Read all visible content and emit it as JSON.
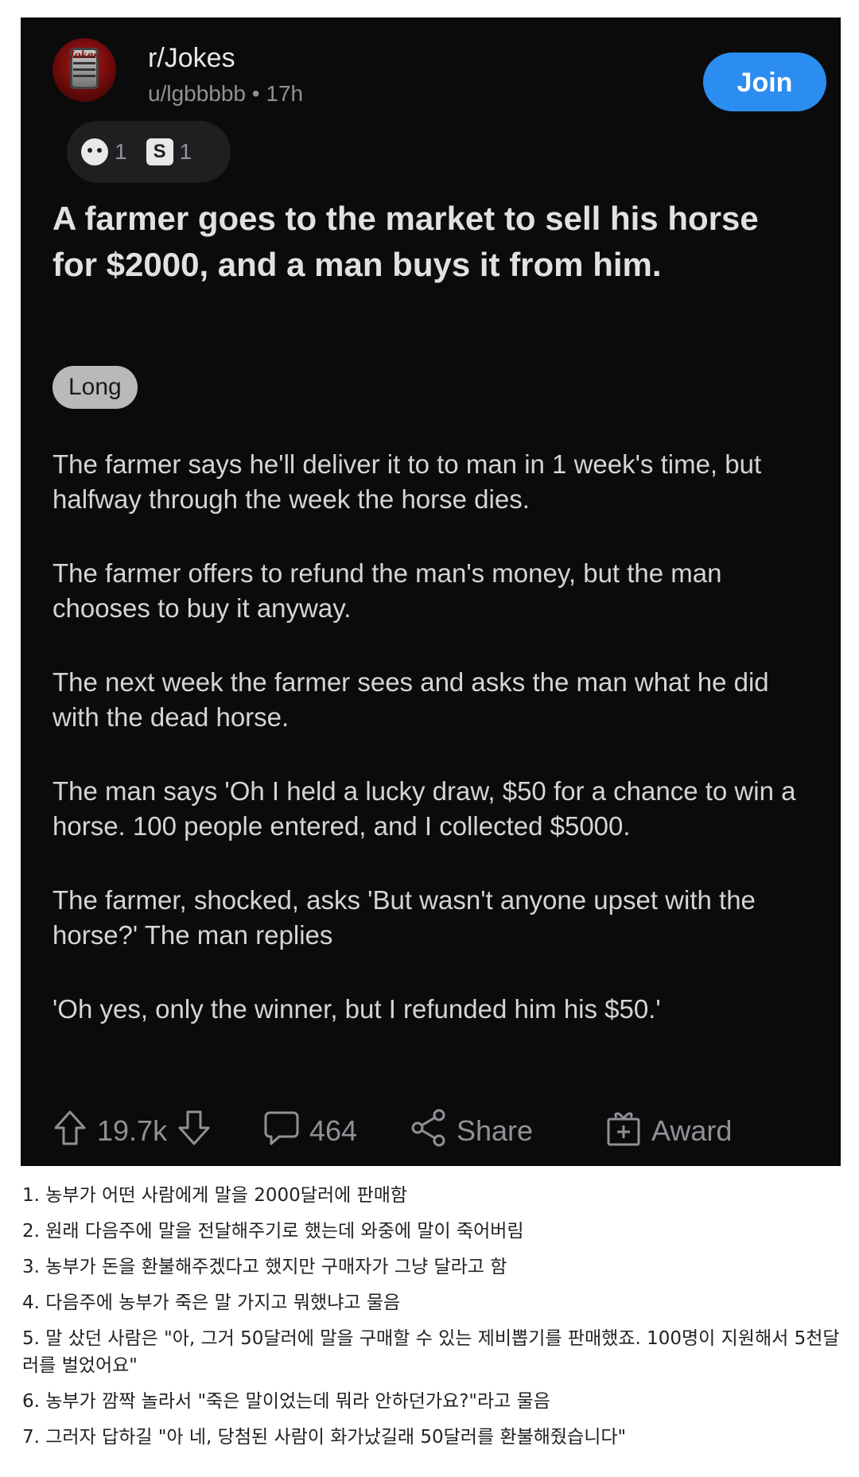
{
  "post": {
    "subreddit": "r/Jokes",
    "author": "u/lgbbbbb",
    "separator": "•",
    "time": "17h",
    "join_label": "Join",
    "avatar_text": "Jokes",
    "awards": [
      {
        "icon": "wholesome-award-icon",
        "count": "1"
      },
      {
        "icon": "silver-award-icon",
        "glyph": "S",
        "count": "1"
      }
    ],
    "title": "A farmer goes to the market to sell his horse for $2000, and a man buys it from him.",
    "flair": "Long",
    "paragraphs": [
      "The farmer says he'll deliver it to to man in 1 week's time, but halfway through the week the horse dies.",
      "The farmer offers to refund the man's money, but the man chooses to buy it anyway.",
      "The next week the farmer sees and asks the man what he did with the dead horse.",
      "The man says 'Oh I held a lucky draw, $50 for a chance to win a horse. 100 people entered, and I collected $5000.",
      "The farmer, shocked, asks 'But wasn't anyone upset with the horse?' The man replies",
      "'Oh yes, only the winner, but I refunded him his $50.'"
    ],
    "actions": {
      "votes": "19.7k",
      "comments": "464",
      "share": "Share",
      "award": "Award"
    }
  },
  "translation": [
    "1. 농부가 어떤 사람에게 말을 2000달러에 판매함",
    "2. 원래 다음주에 말을 전달해주기로 했는데 와중에 말이 죽어버림",
    "3. 농부가 돈을 환불해주겠다고 했지만 구매자가 그냥 달라고 함",
    "4. 다음주에 농부가 죽은 말 가지고 뭐했냐고 물음",
    "5. 말 샀던 사람은 \"아, 그거 50달러에 말을 구매할 수 있는 제비뽑기를 판매했죠. 100명이 지원해서 5천달러를 벌었어요\"",
    "6. 농부가 깜짝 놀라서 \"죽은 말이었는데 뭐라 안하던가요?\"라고 물음",
    "7. 그러자 답하길 \"아 네, 당첨된 사람이 화가났길래 50달러를 환불해줬습니다\""
  ],
  "colors": {
    "card_bg": "#0b0b0c",
    "join_bg": "#2c8df0",
    "flair_bg": "#b9b9b9",
    "muted_text": "#8e9296"
  }
}
